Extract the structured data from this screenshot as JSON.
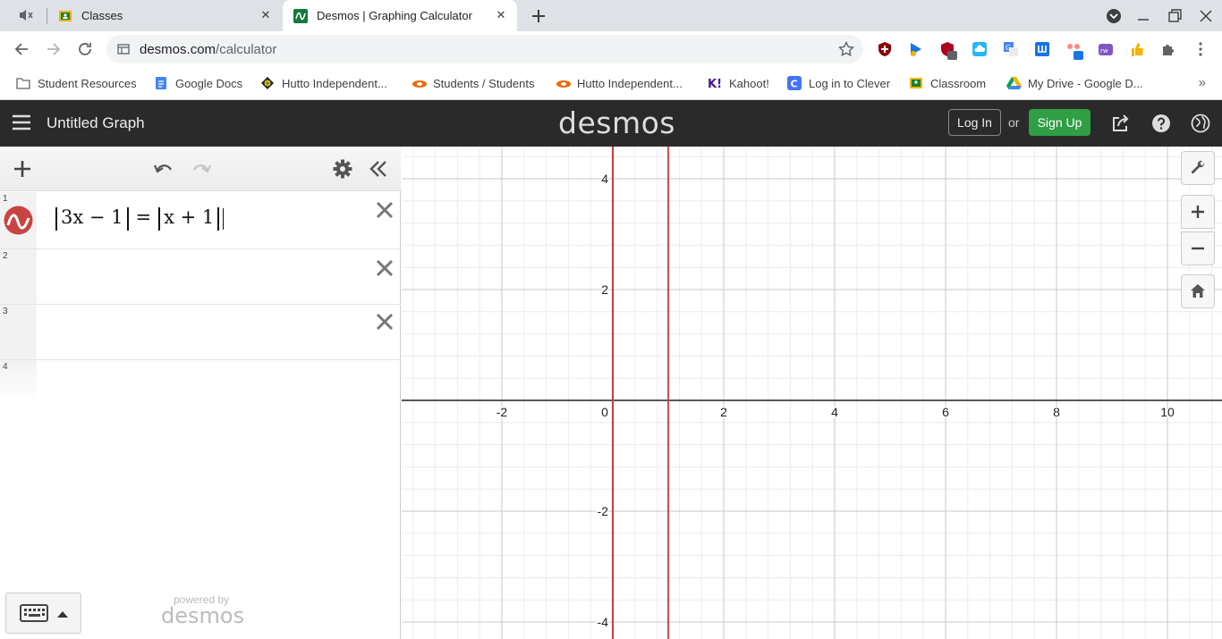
{
  "browser": {
    "tabs": [
      {
        "title": "Classes",
        "active": false
      },
      {
        "title": "Desmos | Graphing Calculator",
        "active": true
      }
    ],
    "url_host": "desmos.com",
    "url_path": "/calculator",
    "extension_badges": [
      "2",
      "1"
    ],
    "bookmarks": [
      "Student Resources",
      "Google Docs",
      "Hutto Independent...",
      "Students / Students",
      "Hutto Independent...",
      "Kahoot!",
      "Log in to Clever",
      "Classroom",
      "My Drive - Google D..."
    ],
    "bookmarks_overflow": "»"
  },
  "header": {
    "graph_title": "Untitled Graph",
    "logo": "desmos",
    "login_label": "Log In",
    "or_label": "or",
    "signup_label": "Sign Up",
    "signup_color": "#2f9e44"
  },
  "expressions": {
    "rows": [
      {
        "index": "1",
        "latex_left_abs": "3x − 1",
        "equals": "=",
        "latex_right_abs": "x + 1",
        "color": "#c74440"
      },
      {
        "index": "2"
      },
      {
        "index": "3"
      },
      {
        "index": "4"
      }
    ],
    "powered_by": "powered by",
    "powered_logo": "desmos"
  },
  "graph": {
    "x_ticks": [
      "-2",
      "0",
      "2",
      "4",
      "6",
      "8",
      "10"
    ],
    "y_ticks": [
      "4",
      "2",
      "-2",
      "-4"
    ],
    "curve_color": "#c74440",
    "solution_lines_x": [
      0,
      1
    ]
  }
}
